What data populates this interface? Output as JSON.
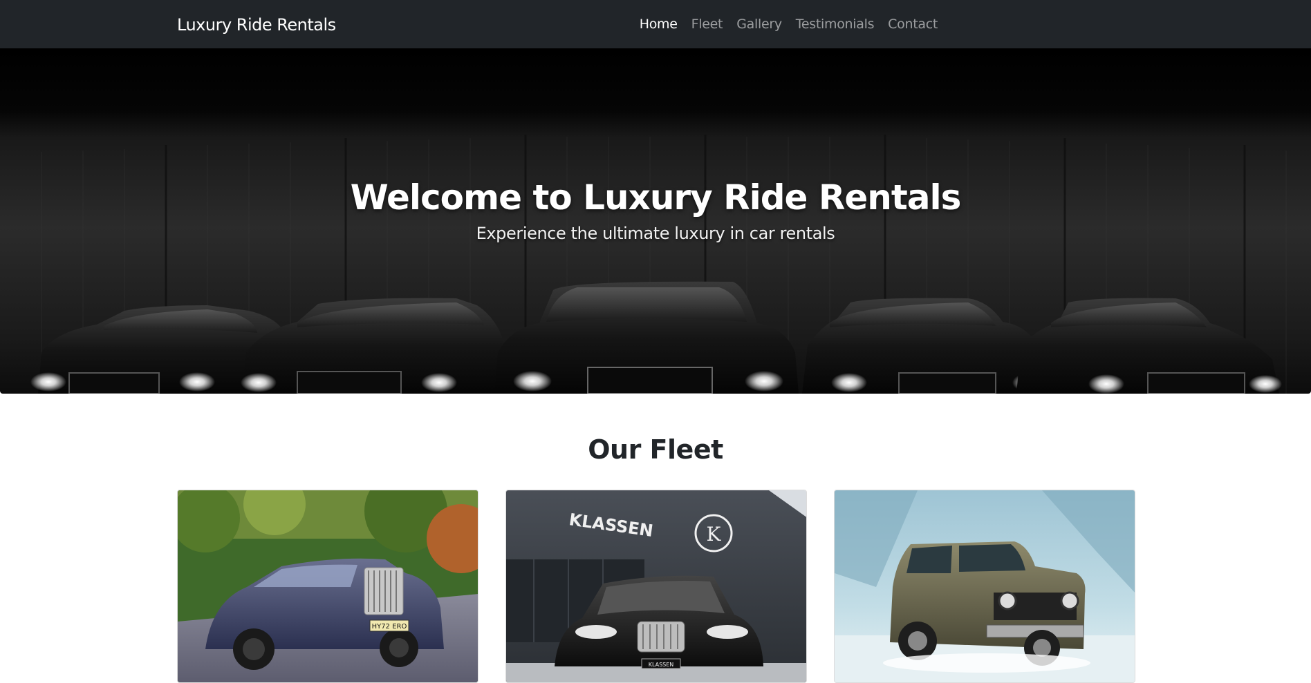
{
  "navbar": {
    "brand": "Luxury Ride Rentals",
    "links": [
      {
        "label": "Home",
        "active": true
      },
      {
        "label": "Fleet",
        "active": false
      },
      {
        "label": "Gallery",
        "active": false
      },
      {
        "label": "Testimonials",
        "active": false
      },
      {
        "label": "Contact",
        "active": false
      }
    ]
  },
  "hero": {
    "title": "Welcome to Luxury Ride Rentals",
    "subtitle": "Experience the ultimate luxury in car rentals"
  },
  "fleet": {
    "title": "Our Fleet",
    "cards": [
      {
        "image": "blue-luxury-sedan-photo",
        "plate": "HY72 ERO"
      },
      {
        "image": "black-sedan-showroom-photo",
        "sign": "KLASSEN",
        "logo_letter": "K",
        "plate": "KLASSEN"
      },
      {
        "image": "green-suv-snow-photo"
      }
    ]
  },
  "colors": {
    "navbar_bg": "#212529",
    "nav_active": "#ffffff",
    "nav_inactive": "rgba(255,255,255,0.55)",
    "heading": "#212529"
  }
}
